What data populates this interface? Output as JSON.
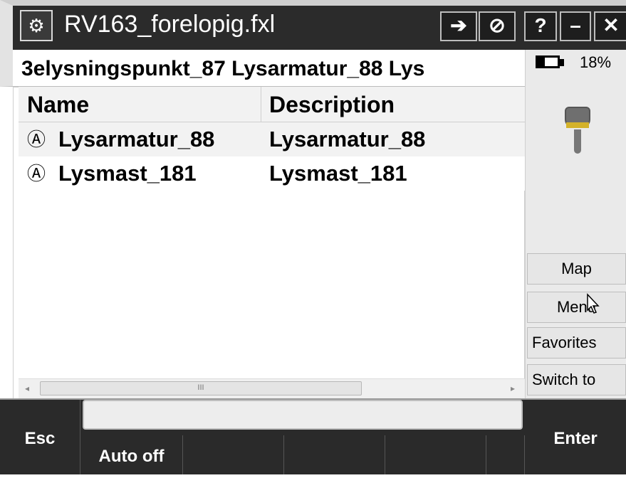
{
  "window": {
    "title": "RV163_forelopig.fxl",
    "app_icon": "trimble-access-icon",
    "buttons": [
      {
        "name": "sign-in-icon",
        "label": "➔"
      },
      {
        "name": "no-entry-icon",
        "label": "⊘"
      },
      {
        "name": "help-button",
        "label": "?"
      },
      {
        "name": "minimize-button",
        "label": "–"
      },
      {
        "name": "close-button",
        "label": "✕"
      }
    ]
  },
  "breadcrumb": "3elysningspunkt_87 Lysarmatur_88 Lys",
  "table": {
    "columns": [
      "Name",
      "Description"
    ],
    "rows": [
      {
        "icon": "Ⓐ",
        "name": "Lysarmatur_88",
        "description": "Lysarmatur_88"
      },
      {
        "icon": "Ⓐ",
        "name": "Lysmast_181",
        "description": "Lysmast_181"
      }
    ],
    "scroll": {
      "left": "◂",
      "right": "▸",
      "thumb": "III"
    }
  },
  "status": {
    "battery_percent": "18%",
    "battery_level": 0.18,
    "receiver_icon": "gnss-receiver-icon"
  },
  "sidebar": {
    "map": "Map",
    "menu": "Menu",
    "favorites": "Favorites",
    "switch_to": "Switch to"
  },
  "softkeys": {
    "esc": "Esc",
    "auto_off": "Auto off",
    "enter": "Enter"
  }
}
